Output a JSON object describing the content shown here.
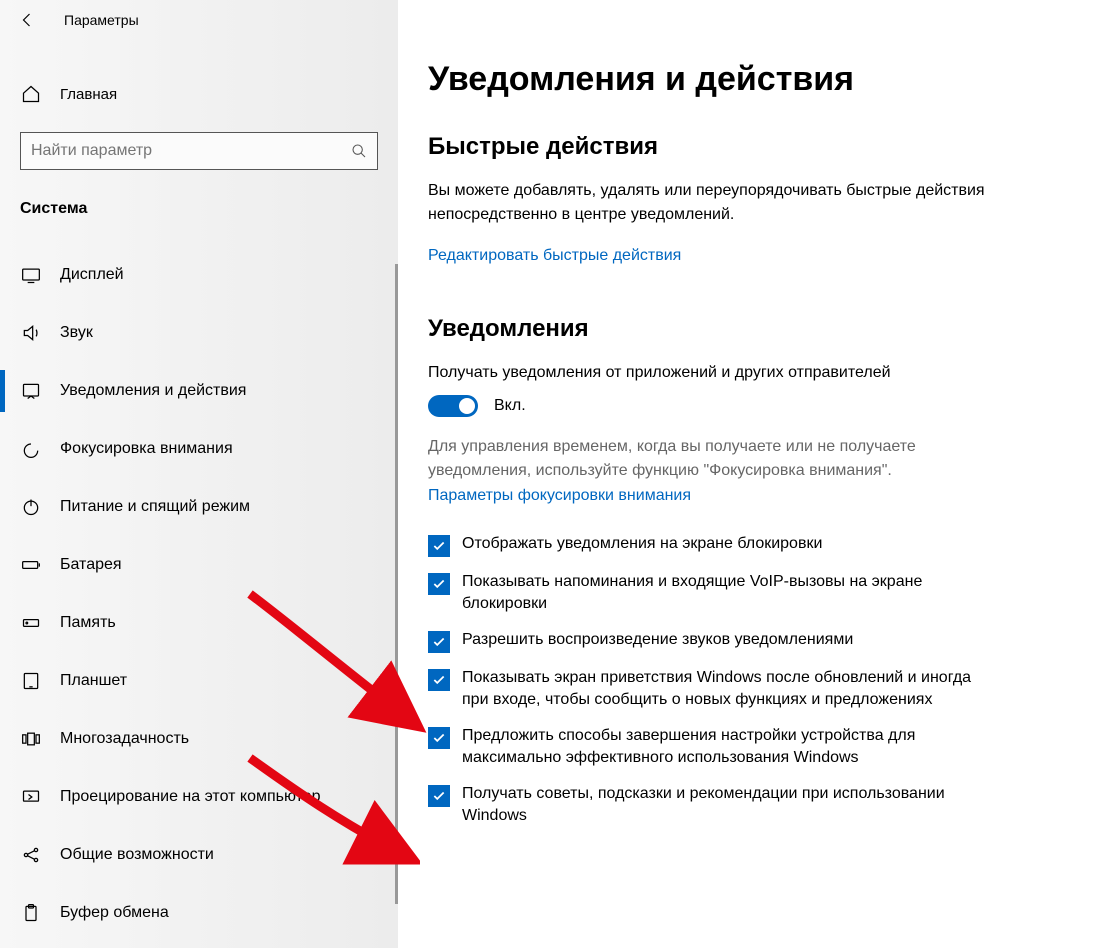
{
  "window": {
    "title": "Параметры"
  },
  "sidebar": {
    "home": "Главная",
    "search_placeholder": "Найти параметр",
    "section": "Система",
    "items": [
      {
        "icon": "display-icon",
        "label": "Дисплей"
      },
      {
        "icon": "sound-icon",
        "label": "Звук"
      },
      {
        "icon": "notifications-icon",
        "label": "Уведомления и действия",
        "active": true
      },
      {
        "icon": "focus-icon",
        "label": "Фокусировка внимания"
      },
      {
        "icon": "power-icon",
        "label": "Питание и спящий режим"
      },
      {
        "icon": "battery-icon",
        "label": "Батарея"
      },
      {
        "icon": "storage-icon",
        "label": "Память"
      },
      {
        "icon": "tablet-icon",
        "label": "Планшет"
      },
      {
        "icon": "multitask-icon",
        "label": "Многозадачность"
      },
      {
        "icon": "project-icon",
        "label": "Проецирование на этот компьютер"
      },
      {
        "icon": "shared-icon",
        "label": "Общие возможности"
      },
      {
        "icon": "clipboard-icon",
        "label": "Буфер обмена"
      }
    ]
  },
  "main": {
    "title": "Уведомления и действия",
    "quick_actions": {
      "heading": "Быстрые действия",
      "desc": "Вы можете добавлять, удалять или переупорядочивать быстрые действия непосредственно в центре уведомлений.",
      "link": "Редактировать быстрые действия"
    },
    "notifications": {
      "heading": "Уведомления",
      "toggle_label": "Получать уведомления от приложений и других отправителей",
      "toggle_state": "Вкл.",
      "muted": "Для управления временем, когда вы получаете или не получаете уведомления, используйте функцию \"Фокусировка внимания\".",
      "focus_link": "Параметры фокусировки внимания",
      "checks": [
        "Отображать уведомления на экране блокировки",
        "Показывать напоминания и входящие VoIP-вызовы на экране блокировки",
        "Разрешить воспроизведение звуков уведомлениями",
        "Показывать экран приветствия Windows после обновлений и иногда при входе, чтобы сообщить о новых функциях и предложениях",
        "Предложить способы завершения настройки устройства для максимально эффективного использования Windows",
        "Получать советы, подсказки и рекомендации при использовании Windows"
      ]
    }
  }
}
